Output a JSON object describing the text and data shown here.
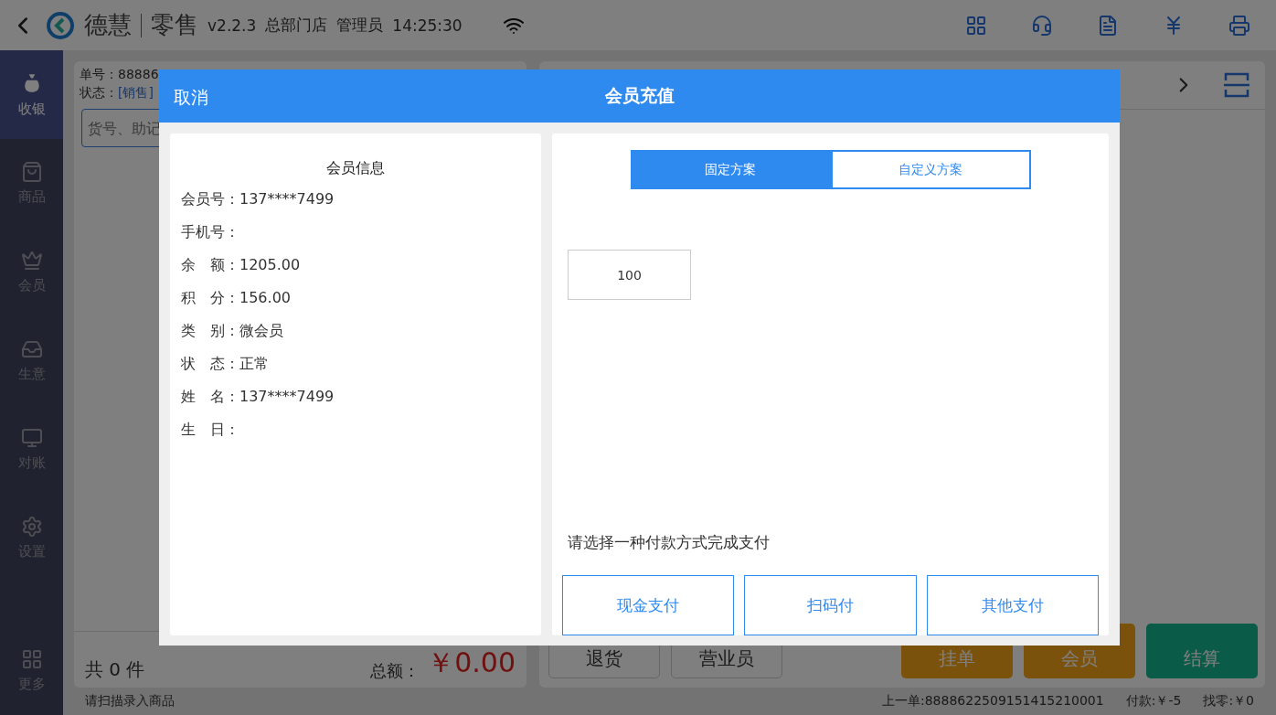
{
  "top_bar": {
    "brand": "德慧",
    "product": "零售",
    "version": "v2.2.3",
    "store": "总部门店",
    "user": "管理员",
    "time": "14:25:30"
  },
  "sidebar": {
    "items": [
      {
        "label": "收银",
        "selected": true
      },
      {
        "label": "商品",
        "selected": false
      },
      {
        "label": "会员",
        "selected": false
      },
      {
        "label": "生意",
        "selected": false
      },
      {
        "label": "对账",
        "selected": false
      },
      {
        "label": "设置",
        "selected": false
      }
    ],
    "more": {
      "label": "更多"
    }
  },
  "order_panel": {
    "order_no": "单号：88886",
    "status_label": "状态：",
    "status": "[销售]",
    "search": {
      "placeholder": "货号、助记"
    },
    "count": "共 0 件",
    "total_label": "总额：",
    "total": "￥0.00"
  },
  "action_panel": {
    "buttons": [
      {
        "label": "退货",
        "kind": "plain"
      },
      {
        "label": "营业员",
        "kind": "plain"
      },
      {
        "label": "挂单",
        "kind": "warn"
      },
      {
        "label": "会员",
        "kind": "warn"
      },
      {
        "label": "结算",
        "kind": "go"
      }
    ]
  },
  "status_bar": {
    "hint": "请扫描录入商品",
    "last_order": "上一单:8888622509151415210001",
    "paid": "付款:￥-5",
    "change": "找零:￥0"
  },
  "dialog": {
    "cancel": "取消",
    "title": "会员充值",
    "member": {
      "heading": "会员信息",
      "lines": [
        "会员号：137****7499",
        "手机号：",
        "余　额：1205.00",
        "积　分：156.00",
        "类　别：微会员",
        "状　态：正常",
        "姓　名：137****7499",
        "生　日："
      ]
    },
    "tabs": [
      {
        "label": "固定方案",
        "selected": true
      },
      {
        "label": "自定义方案",
        "selected": false
      }
    ],
    "amounts": [
      "100"
    ],
    "pay_hint": "请选择一种付款方式完成支付",
    "pay_buttons": [
      "现金支付",
      "扫码付",
      "其他支付"
    ]
  }
}
